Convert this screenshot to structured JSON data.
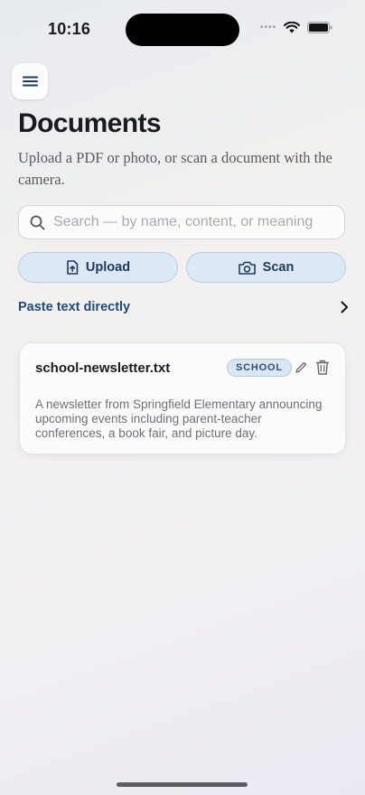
{
  "status_bar": {
    "time": "10:16"
  },
  "header": {
    "title": "Documents",
    "subtitle": "Upload a PDF or photo, or scan a document with the camera."
  },
  "search": {
    "placeholder": "Search — by name, content, or meaning",
    "value": ""
  },
  "actions": {
    "upload_label": "Upload",
    "scan_label": "Scan"
  },
  "paste": {
    "label": "Paste text directly"
  },
  "documents": [
    {
      "name": "school-newsletter.txt",
      "tag": "SCHOOL",
      "description": "A newsletter from Springfield Elementary announcing upcoming events including parent-teacher conferences, a book fair, and picture day."
    }
  ],
  "icons": {
    "menu": "menu-icon",
    "search": "search-icon",
    "upload": "file-upload-icon",
    "scan": "camera-icon",
    "chevron": "chevron-right-icon",
    "edit": "pencil-icon",
    "delete": "trash-icon"
  },
  "colors": {
    "accent": "#1f4a7a",
    "button_bg": "#dde8f5",
    "badge_bg": "#dae6f2"
  }
}
